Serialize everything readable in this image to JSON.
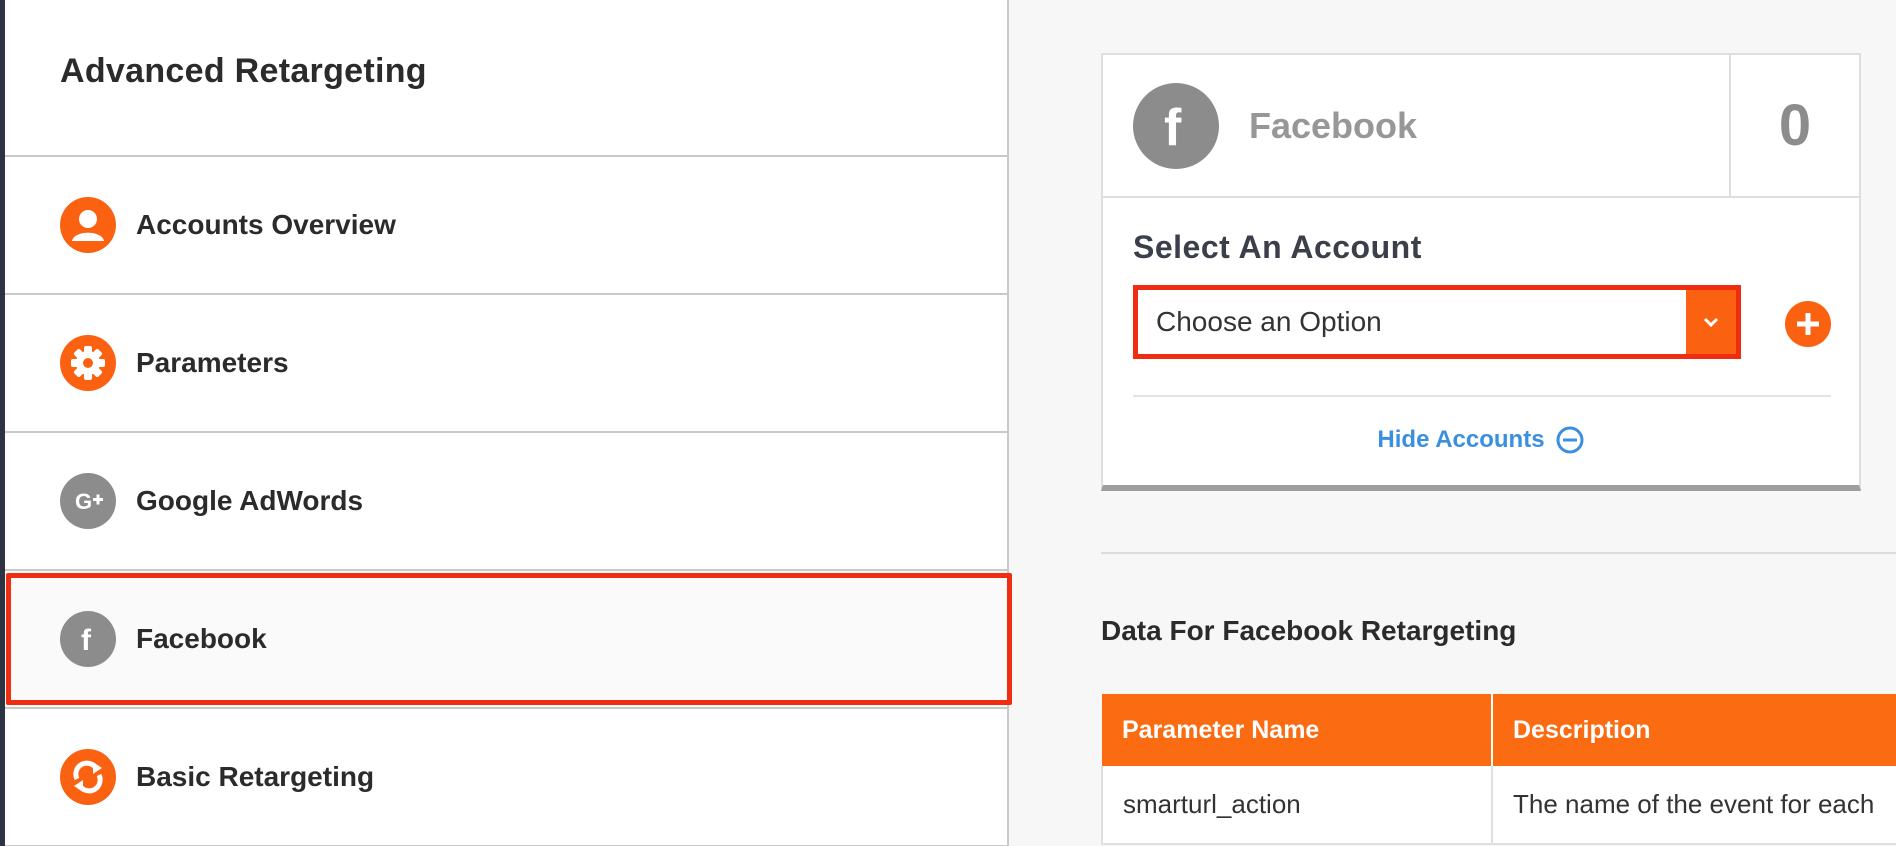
{
  "sidebar": {
    "title": "Advanced Retargeting",
    "items": [
      {
        "label": "Accounts Overview",
        "icon": "user-icon",
        "icon_color": "#fa6212"
      },
      {
        "label": "Parameters",
        "icon": "gear-icon",
        "icon_color": "#fa6212"
      },
      {
        "label": "Google AdWords",
        "icon": "google-plus-icon",
        "icon_color": "#8c8c8c"
      },
      {
        "label": "Facebook",
        "icon": "facebook-icon",
        "icon_color": "#8c8c8c",
        "active": true
      },
      {
        "label": "Basic Retargeting",
        "icon": "refresh-icon",
        "icon_color": "#fa6212"
      }
    ]
  },
  "account_card": {
    "title": "Facebook",
    "count": "0",
    "select_label": "Select An Account",
    "select_value": "Choose an Option",
    "hide_accounts_label": "Hide Accounts"
  },
  "data_section": {
    "title": "Data For Facebook Retargeting",
    "columns": [
      "Parameter Name",
      "Description"
    ],
    "rows": [
      [
        "smarturl_action",
        "The name of the event for each"
      ]
    ]
  },
  "colors": {
    "accent": "#fa6212",
    "highlight": "#f02d10",
    "link": "#3b8fe0",
    "icon_gray": "#8c8c8c"
  }
}
